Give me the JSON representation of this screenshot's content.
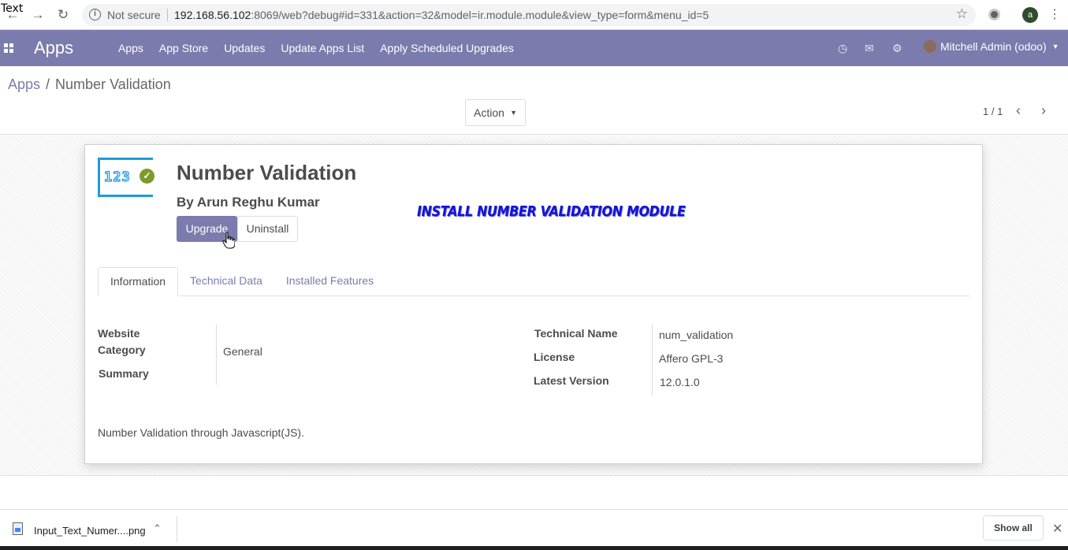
{
  "browser": {
    "overlay_text": "Text",
    "back_icon": "arrow-left-icon",
    "forward_icon": "arrow-right-icon",
    "reload_icon": "reload-icon",
    "not_secure": "Not secure",
    "url_host": "192.168.56.102",
    "url_rest": ":8069/web?debug#id=331&action=32&model=ir.module.module&view_type=form&menu_id=5",
    "profile_letter": "a"
  },
  "navbar": {
    "brand": "Apps",
    "menu": [
      "Apps",
      "App Store",
      "Updates",
      "Update Apps List",
      "Apply Scheduled Upgrades"
    ],
    "user": "Mitchell Admin (odoo)",
    "color": "#7c7bad"
  },
  "control_panel": {
    "breadcrumb_root": "Apps",
    "breadcrumb_separator": "/",
    "breadcrumb_current": "Number Validation",
    "action_label": "Action",
    "pager": "1 / 1"
  },
  "module": {
    "icon_digits": "123",
    "title": "Number Validation",
    "author": "By Arun Reghu Kumar",
    "upgrade_label": "Upgrade",
    "uninstall_label": "Uninstall",
    "annotation": "INSTALL NUMBER VALIDATION MODULE"
  },
  "tabs": [
    "Information",
    "Technical Data",
    "Installed Features"
  ],
  "info": {
    "website_label": "Website",
    "category_label": "Category",
    "category_value": "General",
    "summary_label": "Summary",
    "technical_name_label": "Technical Name",
    "technical_name_value": "num_validation",
    "license_label": "License",
    "license_value": "Affero GPL-3",
    "latest_version_label": "Latest Version",
    "latest_version_value": "12.0.1.0",
    "description": "Number Validation through Javascript(JS)."
  },
  "downloads": {
    "file_name": "Input_Text_Numer....png",
    "show_all": "Show all"
  }
}
